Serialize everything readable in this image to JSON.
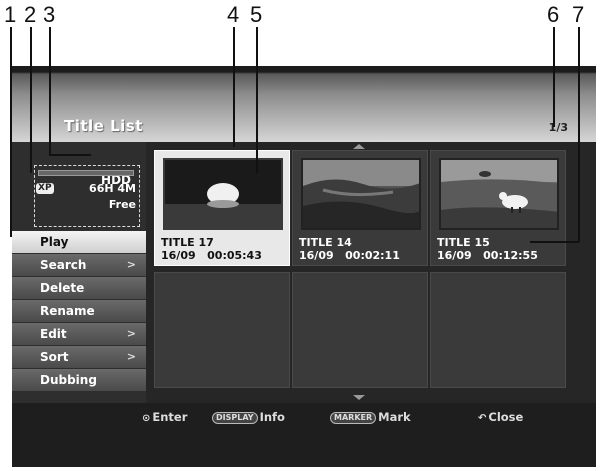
{
  "callouts": [
    "1",
    "2",
    "3",
    "4",
    "5",
    "6",
    "7"
  ],
  "header": {
    "title": "Title List",
    "page": "1/3"
  },
  "disk": {
    "label": "HDD",
    "mode": "XP",
    "remaining": "66H 4M",
    "free": "Free",
    "used_fraction": 0.02
  },
  "menu": [
    {
      "label": "Play",
      "arrow": "",
      "selected": true
    },
    {
      "label": "Search",
      "arrow": ">"
    },
    {
      "label": "Delete",
      "arrow": ""
    },
    {
      "label": "Rename",
      "arrow": ""
    },
    {
      "label": "Edit",
      "arrow": ">"
    },
    {
      "label": "Sort",
      "arrow": ">"
    },
    {
      "label": "Dubbing",
      "arrow": ""
    }
  ],
  "titles": [
    {
      "title": "TITLE 17",
      "date": "16/09",
      "duration": "00:05:43",
      "selected": true,
      "thumb_icon": "sun-thumbnail-icon"
    },
    {
      "title": "TITLE 14",
      "date": "16/09",
      "duration": "00:02:11",
      "thumb_icon": "landscape-thumbnail-icon"
    },
    {
      "title": "TITLE 15",
      "date": "16/09",
      "duration": "00:12:55",
      "thumb_icon": "animal-thumbnail-icon"
    }
  ],
  "footer": {
    "enter": "Enter",
    "display_key": "DISPLAY",
    "info": "Info",
    "marker_key": "MARKER",
    "mark": "Mark",
    "close": "Close"
  },
  "colors": {
    "screen_bg": "#262626",
    "selected_bg": "#e8e8e8",
    "menu_bg": "#5a5a5a"
  }
}
